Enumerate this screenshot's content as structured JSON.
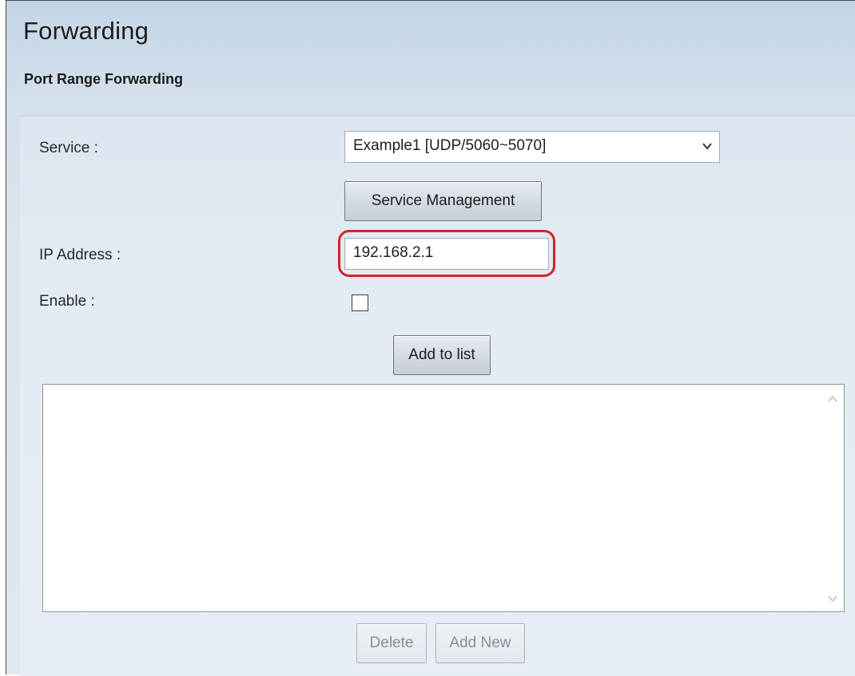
{
  "page": {
    "title": "Forwarding",
    "section_title": "Port Range Forwarding"
  },
  "form": {
    "service_label": "Service :",
    "service_selected": "Example1 [UDP/5060~5070]",
    "service_management_label": "Service Management",
    "ip_label": "IP Address :",
    "ip_value": "192.168.2.1",
    "enable_label": "Enable :",
    "enable_checked": false,
    "add_to_list_label": "Add to list"
  },
  "list": {
    "items": []
  },
  "actions": {
    "delete_label": "Delete",
    "add_new_label": "Add New"
  },
  "colors": {
    "highlight": "#d8222a",
    "background": "#dfe8f0"
  },
  "icons": {
    "dropdown": "chevron-down-icon",
    "scroll_up": "chevron-up-icon",
    "scroll_down": "chevron-down-icon"
  }
}
